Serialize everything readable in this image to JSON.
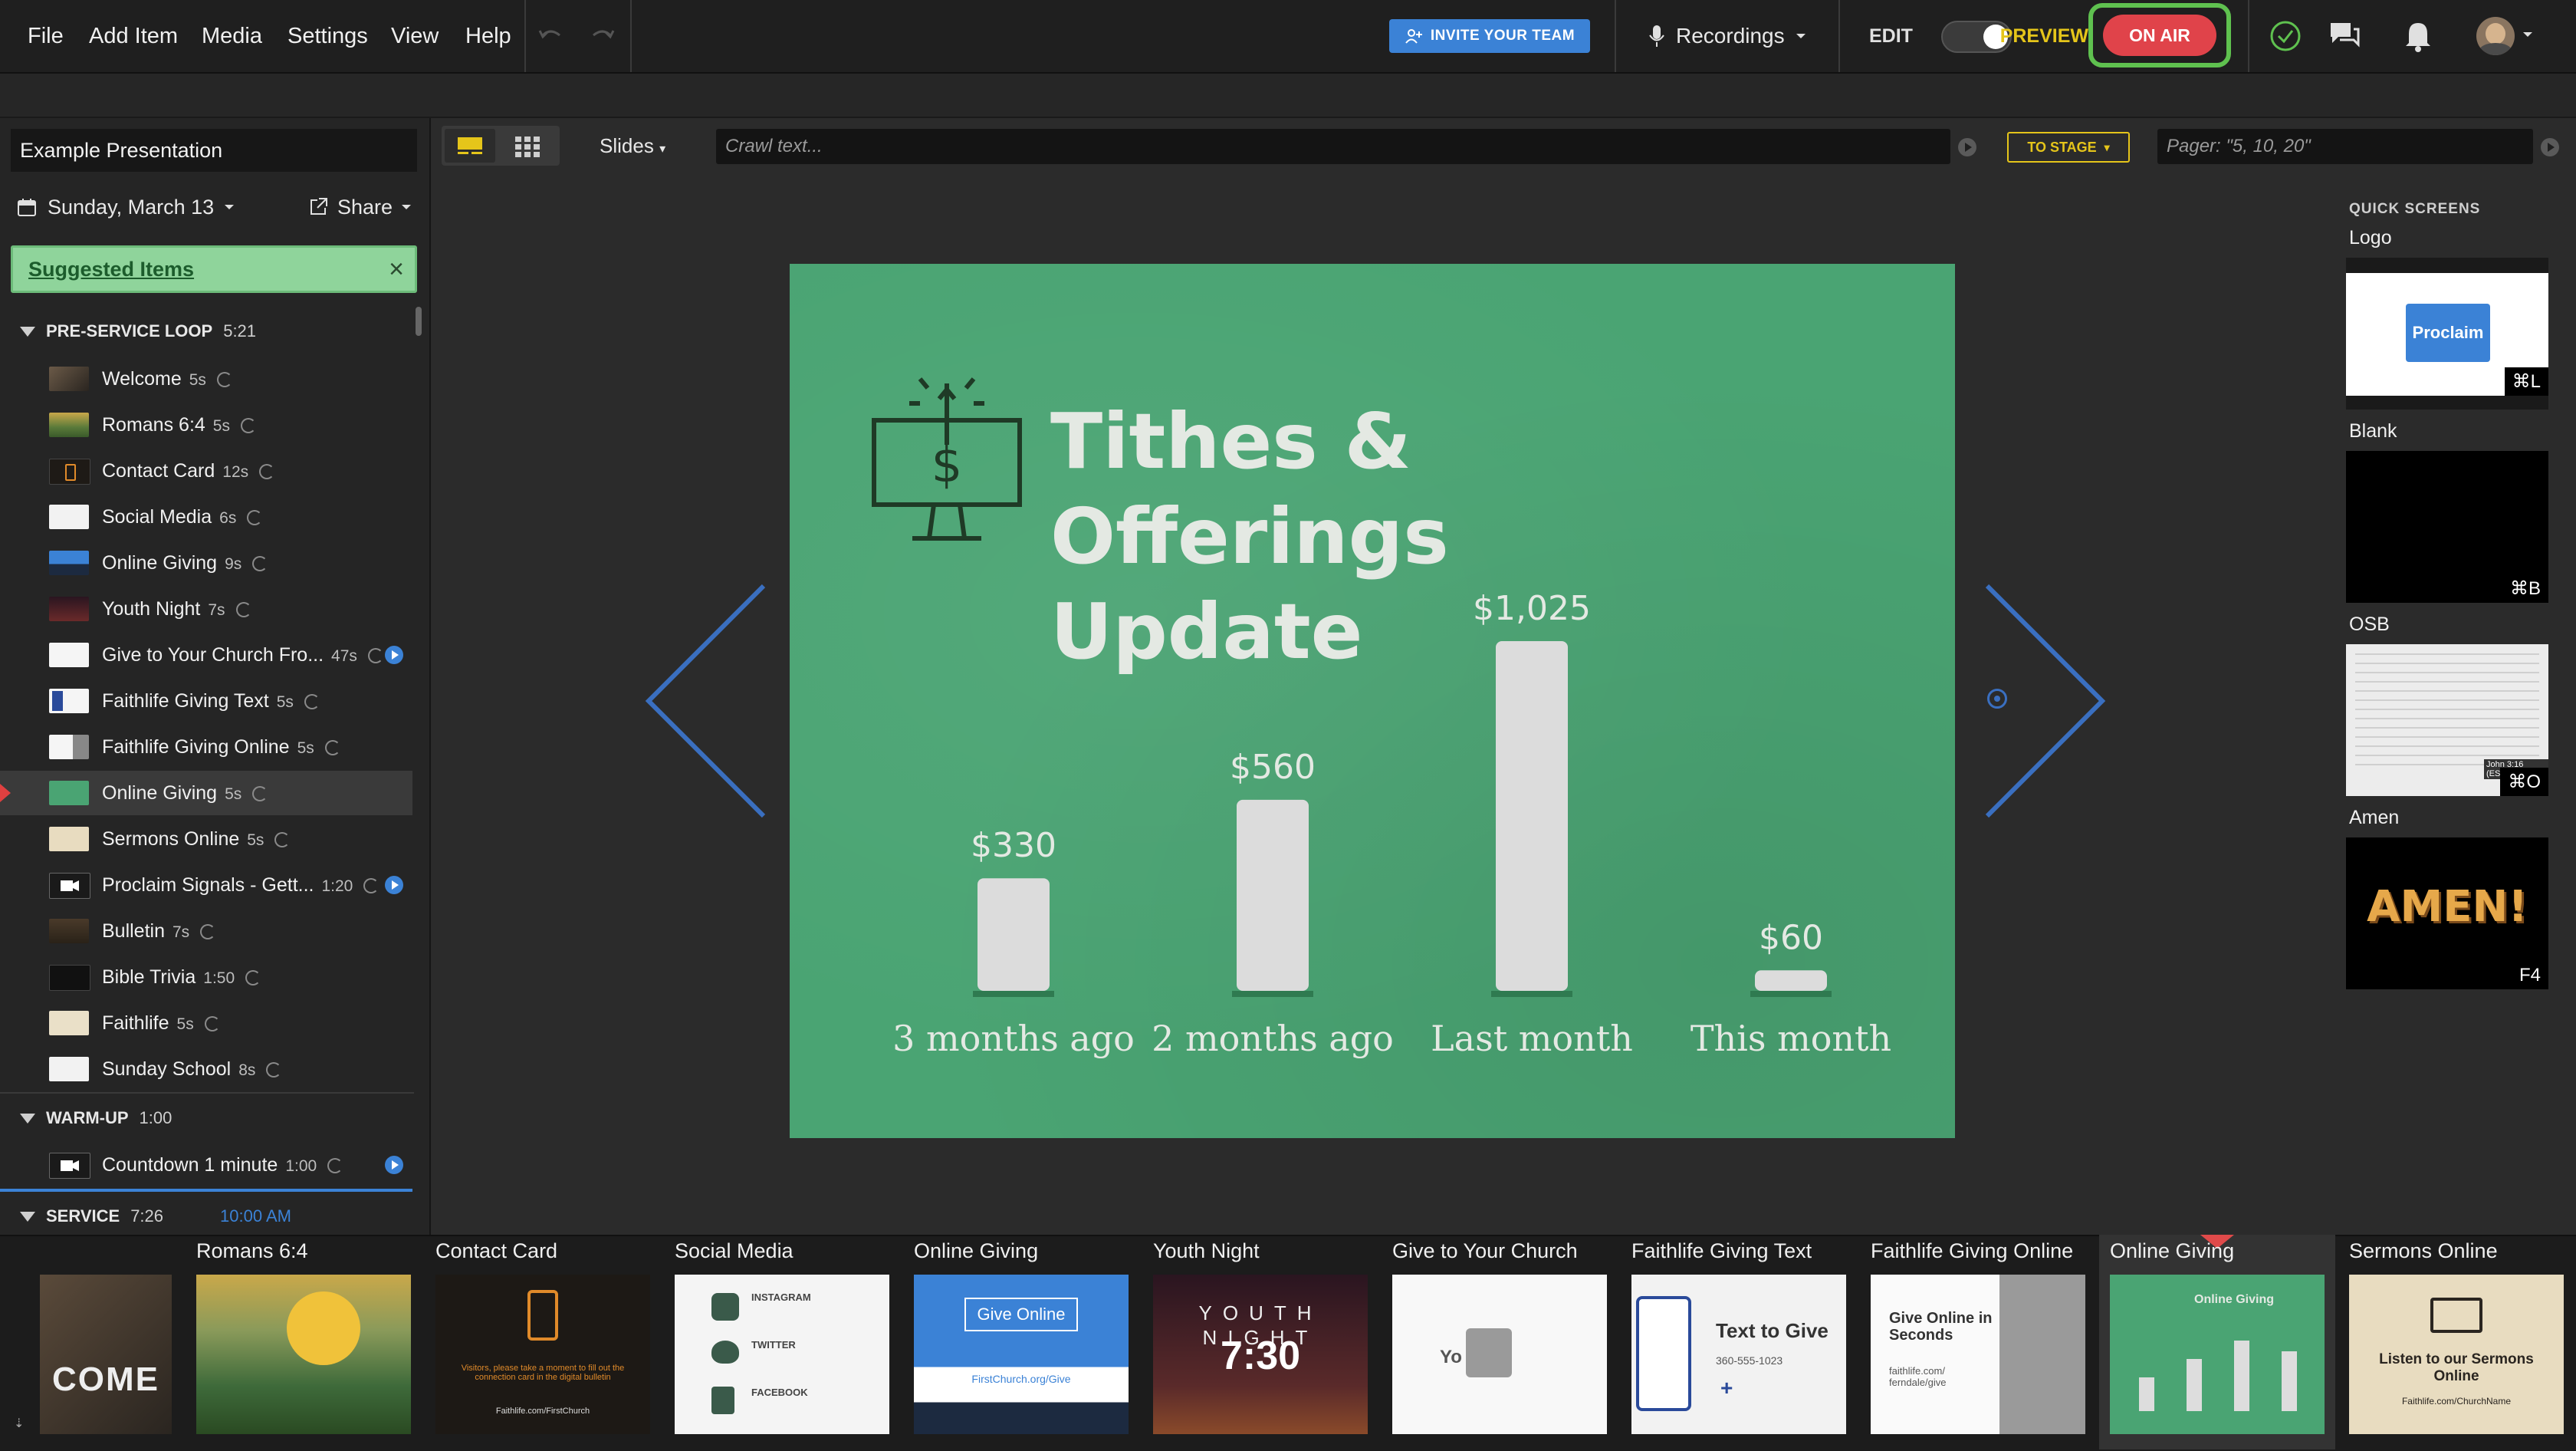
{
  "menu": [
    "File",
    "Add Item",
    "Media",
    "Settings",
    "View",
    "Help"
  ],
  "topbar": {
    "invite_label": "INVITE YOUR TEAM",
    "recordings_label": "Recordings",
    "edit_label": "EDIT",
    "preview_label": "PREVIEW",
    "on_air_label": "ON AIR"
  },
  "left": {
    "presentation_title": "Example Presentation",
    "date_label": "Sunday, March 13",
    "share_label": "Share",
    "suggested_label": "Suggested Items",
    "sections": [
      {
        "name": "PRE-SERVICE LOOP",
        "duration": "5:21"
      },
      {
        "name": "WARM-UP",
        "duration": "1:00"
      },
      {
        "name": "SERVICE",
        "duration": "7:26",
        "time": "10:00 AM"
      }
    ],
    "items": [
      {
        "title": "Welcome",
        "duration": "5s"
      },
      {
        "title": "Romans 6:4",
        "duration": "5s"
      },
      {
        "title": "Contact Card",
        "duration": "12s"
      },
      {
        "title": "Social Media",
        "duration": "6s"
      },
      {
        "title": "Online Giving",
        "duration": "9s"
      },
      {
        "title": "Youth Night",
        "duration": "7s"
      },
      {
        "title": "Give to Your Church Fro...",
        "duration": "47s"
      },
      {
        "title": "Faithlife Giving Text",
        "duration": "5s"
      },
      {
        "title": "Faithlife Giving Online",
        "duration": "5s"
      },
      {
        "title": "Online Giving",
        "duration": "5s"
      },
      {
        "title": "Sermons Online",
        "duration": "5s"
      },
      {
        "title": "Proclaim Signals - Gett...",
        "duration": "1:20"
      },
      {
        "title": "Bulletin",
        "duration": "7s"
      },
      {
        "title": "Bible Trivia",
        "duration": "1:50"
      },
      {
        "title": "Faithlife",
        "duration": "5s"
      },
      {
        "title": "Sunday School",
        "duration": "8s"
      }
    ],
    "warmup_items": [
      {
        "title": "Countdown 1 minute",
        "duration": "1:00"
      }
    ]
  },
  "toolbar": {
    "slides_label": "Slides",
    "crawl_placeholder": "Crawl text...",
    "to_stage_label": "TO STAGE",
    "pager_placeholder": "Pager: \"5, 10, 20\""
  },
  "slide": {
    "title_line1": "Tithes & Offerings",
    "title_line2": "Update"
  },
  "chart_data": {
    "type": "bar",
    "title": "Tithes & Offerings Update",
    "categories": [
      "3 months ago",
      "2 months ago",
      "Last month",
      "This month"
    ],
    "values": [
      330,
      560,
      1025,
      60
    ],
    "value_labels": [
      "$330",
      "$560",
      "$1,025",
      "$60"
    ],
    "ylim": [
      0,
      1025
    ],
    "grid": false,
    "bar_color": "#dcdcdc",
    "background_color": "#4aa473"
  },
  "quick_screens": {
    "header": "QUICK SCREENS",
    "items": [
      {
        "name": "Logo",
        "key": "⌘L",
        "content": "Proclaim"
      },
      {
        "name": "Blank",
        "key": "⌘B"
      },
      {
        "name": "OSB",
        "key": "⌘O",
        "content": "John 3:16 (ESV)"
      },
      {
        "name": "Amen",
        "key": "F4",
        "content": "AMEN!"
      }
    ]
  },
  "filmstrip": [
    {
      "label": "",
      "text": "COME"
    },
    {
      "label": "Romans 6:4"
    },
    {
      "label": "Contact Card",
      "text": "Visitors, please take a moment to fill out the connection card in the digital bulletin",
      "footer": "Faithlife.com/FirstChurch"
    },
    {
      "label": "Social Media",
      "lines": [
        "INSTAGRAM",
        "TWITTER",
        "FACEBOOK"
      ]
    },
    {
      "label": "Online Giving",
      "button": "Give Online",
      "url": "FirstChurch.org/Give"
    },
    {
      "label": "Youth Night",
      "text": "YOUTH NIGHT",
      "time": "7:30"
    },
    {
      "label": "Give to Your Church",
      "text": "Yo    rch"
    },
    {
      "label": "Faithlife Giving Text",
      "text": "Text to Give",
      "number": "360-555-1023"
    },
    {
      "label": "Faithlife Giving Online",
      "text": "Give Online in Seconds",
      "url": "faithlife.com/ ferndale/give"
    },
    {
      "label": "Online Giving",
      "text": "Online Giving"
    },
    {
      "label": "Sermons Online",
      "text": "Listen to our Sermons Online",
      "url": "Faithlife.com/ChurchName"
    }
  ],
  "colors": {
    "accent": "#3b82d6",
    "on_air": "#e0434a",
    "preview": "#e5c51a",
    "suggested_bg": "#8fd49b",
    "slide_green": "#4aa473"
  }
}
